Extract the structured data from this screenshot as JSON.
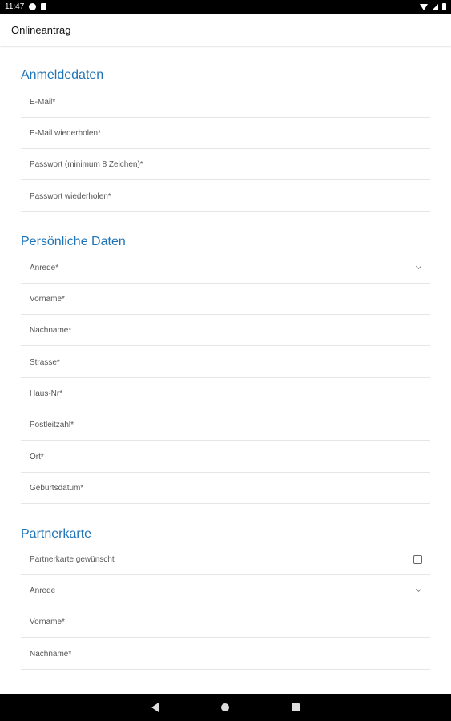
{
  "status_bar": {
    "time": "11:47"
  },
  "app_bar": {
    "title": "Onlineantrag"
  },
  "sections": {
    "login": {
      "title": "Anmeldedaten",
      "fields": [
        "E-Mail*",
        "E-Mail wiederholen*",
        "Passwort (minimum 8 Zeichen)*",
        "Passwort wiederholen*"
      ]
    },
    "personal": {
      "title": "Persönliche Daten",
      "fields": [
        "Anrede*",
        "Vorname*",
        "Nachname*",
        "Strasse*",
        "Haus-Nr*",
        "Postleitzahl*",
        "Ort*",
        "Geburtsdatum*"
      ]
    },
    "partner": {
      "title": "Partnerkarte",
      "fields": [
        "Partnerkarte gewünscht",
        "Anrede",
        "Vorname*",
        "Nachname*"
      ]
    }
  },
  "colors": {
    "section_title": "#1f74b8",
    "status_bar": "#000000",
    "nav_bar": "#000000"
  },
  "icons": [
    "g-icon",
    "file-icon",
    "wifi-icon",
    "signal-icon",
    "battery-icon",
    "chevron-down-icon",
    "checkbox",
    "back-icon",
    "home-icon",
    "recents-icon"
  ]
}
